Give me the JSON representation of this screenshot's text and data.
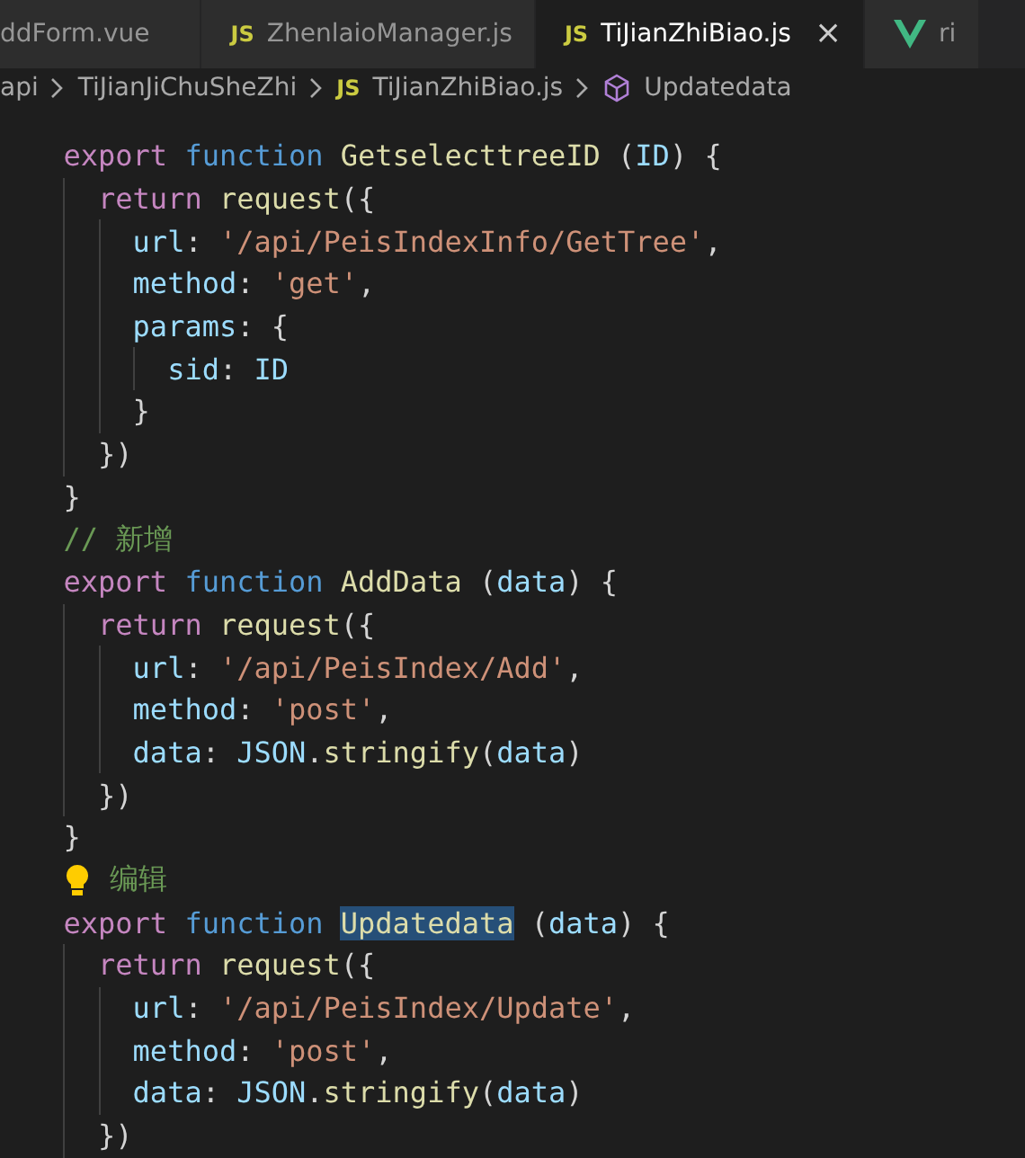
{
  "tabs": [
    {
      "label": "ddForm.vue",
      "kind": "plain",
      "selected": false,
      "closable": false
    },
    {
      "label": "ZhenlaioManager.js",
      "kind": "js",
      "icon_text": "JS",
      "selected": false,
      "closable": false
    },
    {
      "label": "TiJianZhiBiao.js",
      "kind": "js",
      "icon_text": "JS",
      "selected": true,
      "closable": true,
      "close_glyph": "×"
    },
    {
      "label": "ri",
      "kind": "vue",
      "selected": false,
      "closable": false
    }
  ],
  "breadcrumb": [
    {
      "label": "api",
      "kind": "folder"
    },
    {
      "label": "TiJianJiChuSheZhi",
      "kind": "folder"
    },
    {
      "label": "TiJianZhiBiao.js",
      "kind": "js",
      "icon_text": "JS"
    },
    {
      "label": "Updatedata",
      "kind": "symbol"
    }
  ],
  "lines": [
    {
      "lightbulb": false,
      "tokens": [
        {
          "text": "  export ",
          "kind": "control"
        },
        {
          "text": "function ",
          "kind": "storage"
        },
        {
          "text": "GetselecttreeID",
          "kind": "func"
        },
        {
          "text": " ("
        },
        {
          "text": "ID",
          "kind": "var"
        },
        {
          "text": ") {"
        }
      ]
    },
    {
      "lightbulb": false,
      "tokens": [
        {
          "text": "    return ",
          "kind": "control"
        },
        {
          "text": "request",
          "kind": "func"
        },
        {
          "text": "({"
        }
      ]
    },
    {
      "lightbulb": false,
      "tokens": [
        {
          "text": "      url",
          "kind": "var"
        },
        {
          "text": ": "
        },
        {
          "text": "'/api/PeisIndexInfo/GetTree'",
          "kind": "string"
        },
        {
          "text": ","
        }
      ]
    },
    {
      "lightbulb": false,
      "tokens": [
        {
          "text": "      method",
          "kind": "var"
        },
        {
          "text": ": "
        },
        {
          "text": "'get'",
          "kind": "string"
        },
        {
          "text": ","
        }
      ]
    },
    {
      "lightbulb": false,
      "tokens": [
        {
          "text": "      params",
          "kind": "var"
        },
        {
          "text": ": {"
        }
      ]
    },
    {
      "lightbulb": false,
      "tokens": [
        {
          "text": "        sid",
          "kind": "var"
        },
        {
          "text": ": "
        },
        {
          "text": "ID",
          "kind": "var"
        }
      ]
    },
    {
      "lightbulb": false,
      "tokens": [
        {
          "text": "      }"
        }
      ]
    },
    {
      "lightbulb": false,
      "tokens": [
        {
          "text": "    })"
        }
      ]
    },
    {
      "lightbulb": false,
      "tokens": [
        {
          "text": "  }"
        }
      ]
    },
    {
      "lightbulb": false,
      "tokens": [
        {
          "text": "  // 新增",
          "kind": "comment"
        }
      ]
    },
    {
      "lightbulb": false,
      "tokens": [
        {
          "text": "  export ",
          "kind": "control"
        },
        {
          "text": "function ",
          "kind": "storage"
        },
        {
          "text": "AddData",
          "kind": "func"
        },
        {
          "text": " ("
        },
        {
          "text": "data",
          "kind": "var"
        },
        {
          "text": ") {"
        }
      ]
    },
    {
      "lightbulb": false,
      "tokens": [
        {
          "text": "    return ",
          "kind": "control"
        },
        {
          "text": "request",
          "kind": "func"
        },
        {
          "text": "({"
        }
      ]
    },
    {
      "lightbulb": false,
      "tokens": [
        {
          "text": "      url",
          "kind": "var"
        },
        {
          "text": ": "
        },
        {
          "text": "'/api/PeisIndex/Add'",
          "kind": "string"
        },
        {
          "text": ","
        }
      ]
    },
    {
      "lightbulb": false,
      "tokens": [
        {
          "text": "      method",
          "kind": "var"
        },
        {
          "text": ": "
        },
        {
          "text": "'post'",
          "kind": "string"
        },
        {
          "text": ","
        }
      ]
    },
    {
      "lightbulb": false,
      "tokens": [
        {
          "text": "      data",
          "kind": "var"
        },
        {
          "text": ": "
        },
        {
          "text": "JSON",
          "kind": "var"
        },
        {
          "text": "."
        },
        {
          "text": "stringify",
          "kind": "func"
        },
        {
          "text": "("
        },
        {
          "text": "data",
          "kind": "var"
        },
        {
          "text": ")"
        }
      ]
    },
    {
      "lightbulb": false,
      "tokens": [
        {
          "text": "    })"
        }
      ]
    },
    {
      "lightbulb": false,
      "tokens": [
        {
          "text": "  }"
        }
      ]
    },
    {
      "lightbulb": true,
      "tokens": [
        {
          "text": "编辑",
          "kind": "comment"
        }
      ]
    },
    {
      "lightbulb": false,
      "tokens": [
        {
          "text": "  export ",
          "kind": "control"
        },
        {
          "text": "function ",
          "kind": "storage"
        },
        {
          "text": "Updatedata",
          "kind": "func",
          "selected": true
        },
        {
          "text": " ("
        },
        {
          "text": "data",
          "kind": "var"
        },
        {
          "text": ") {"
        }
      ]
    },
    {
      "lightbulb": false,
      "tokens": [
        {
          "text": "    return ",
          "kind": "control"
        },
        {
          "text": "request",
          "kind": "func"
        },
        {
          "text": "({"
        }
      ]
    },
    {
      "lightbulb": false,
      "tokens": [
        {
          "text": "      url",
          "kind": "var"
        },
        {
          "text": ": "
        },
        {
          "text": "'/api/PeisIndex/Update'",
          "kind": "string"
        },
        {
          "text": ","
        }
      ]
    },
    {
      "lightbulb": false,
      "tokens": [
        {
          "text": "      method",
          "kind": "var"
        },
        {
          "text": ": "
        },
        {
          "text": "'post'",
          "kind": "string"
        },
        {
          "text": ","
        }
      ]
    },
    {
      "lightbulb": false,
      "tokens": [
        {
          "text": "      data",
          "kind": "var"
        },
        {
          "text": ": "
        },
        {
          "text": "JSON",
          "kind": "var"
        },
        {
          "text": "."
        },
        {
          "text": "stringify",
          "kind": "func"
        },
        {
          "text": "("
        },
        {
          "text": "data",
          "kind": "var"
        },
        {
          "text": ")"
        }
      ]
    },
    {
      "lightbulb": false,
      "tokens": [
        {
          "text": "    })"
        }
      ]
    }
  ]
}
